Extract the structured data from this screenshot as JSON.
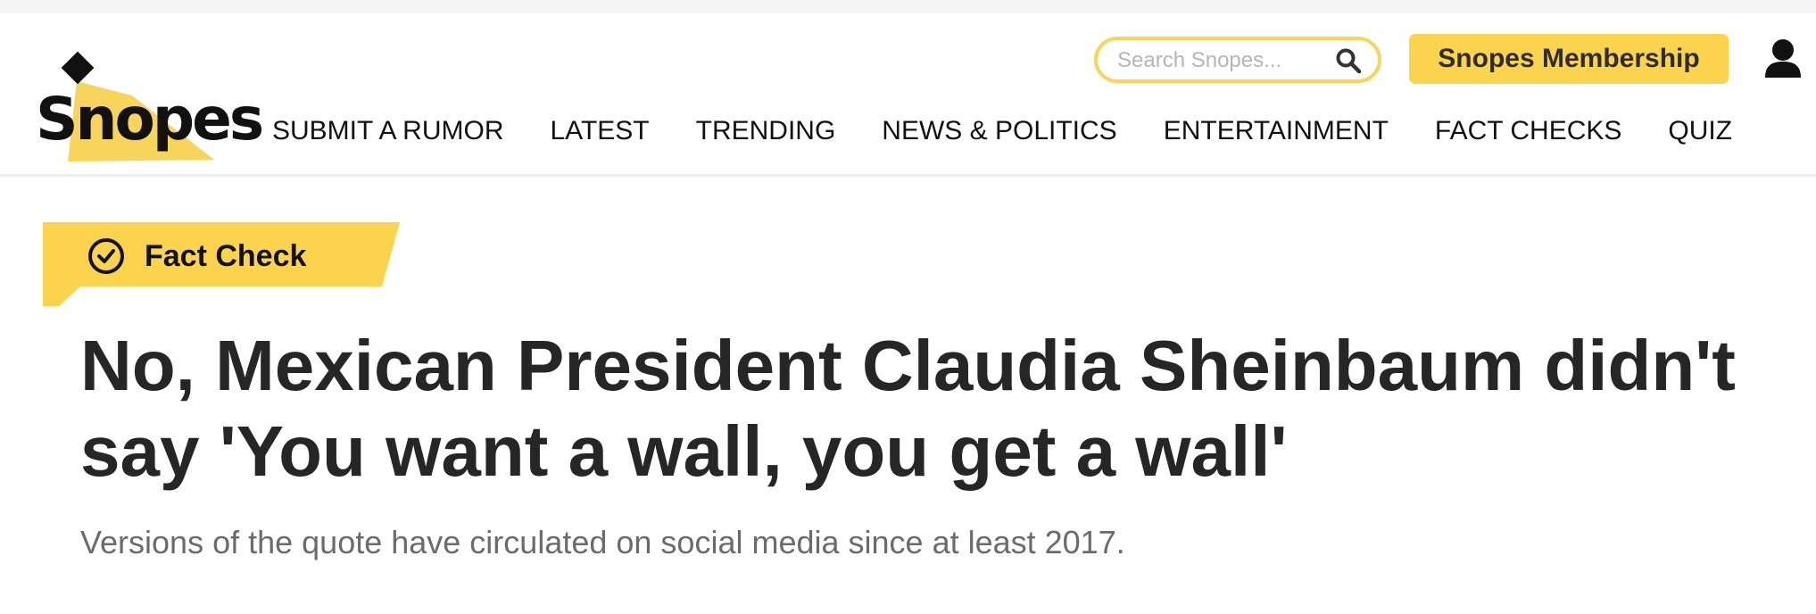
{
  "brand": {
    "logo_text": "Snopes",
    "accent_color": "#fcd34d"
  },
  "search": {
    "placeholder": "Search Snopes...",
    "value": ""
  },
  "header": {
    "membership_label": "Snopes Membership"
  },
  "nav": {
    "items": [
      {
        "label": "SUBMIT A RUMOR"
      },
      {
        "label": "LATEST"
      },
      {
        "label": "TRENDING"
      },
      {
        "label": "NEWS & POLITICS"
      },
      {
        "label": "ENTERTAINMENT"
      },
      {
        "label": "FACT CHECKS"
      },
      {
        "label": "QUIZ"
      }
    ]
  },
  "article": {
    "badge_label": "Fact Check",
    "title": "No, Mexican President Claudia Sheinbaum didn't say 'You want a wall, you get a wall'",
    "subtitle": "Versions of the quote have circulated on social media since at least 2017."
  },
  "icons": {
    "search": "search-icon",
    "user": "user-icon",
    "badge": "check-circle-icon"
  }
}
